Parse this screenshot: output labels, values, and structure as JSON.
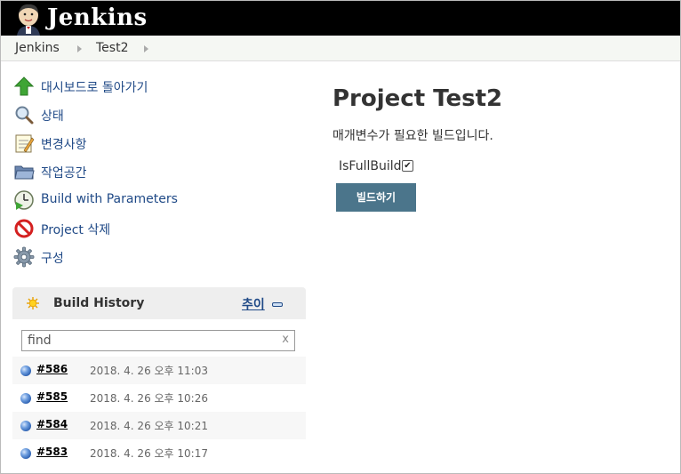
{
  "header": {
    "logo_text": "Jenkins"
  },
  "breadcrumb": {
    "items": [
      "Jenkins",
      "Test2"
    ]
  },
  "tasks": [
    {
      "label": "대시보드로 돌아가기",
      "icon": "up-arrow-icon"
    },
    {
      "label": "상태",
      "icon": "search-icon"
    },
    {
      "label": "변경사항",
      "icon": "notepad-icon"
    },
    {
      "label": "작업공간",
      "icon": "folder-icon"
    },
    {
      "label": "Build with Parameters",
      "icon": "clock-play-icon"
    },
    {
      "label": "Project 삭제",
      "icon": "no-entry-icon"
    },
    {
      "label": "구성",
      "icon": "gear-icon"
    }
  ],
  "build_history": {
    "title": "Build History",
    "trend_label": "추이",
    "filter_placeholder": "find",
    "clear_label": "x",
    "builds": [
      {
        "number": "#586",
        "date": "2018. 4. 26 오후 11:03"
      },
      {
        "number": "#585",
        "date": "2018. 4. 26 오후 10:26"
      },
      {
        "number": "#584",
        "date": "2018. 4. 26 오후 10:21"
      },
      {
        "number": "#583",
        "date": "2018. 4. 26 오후 10:17"
      }
    ]
  },
  "main": {
    "title": "Project Test2",
    "description": "매개변수가 필요한 빌드입니다.",
    "param_label": "IsFullBuild",
    "param_checked": true,
    "build_button": "빌드하기"
  }
}
